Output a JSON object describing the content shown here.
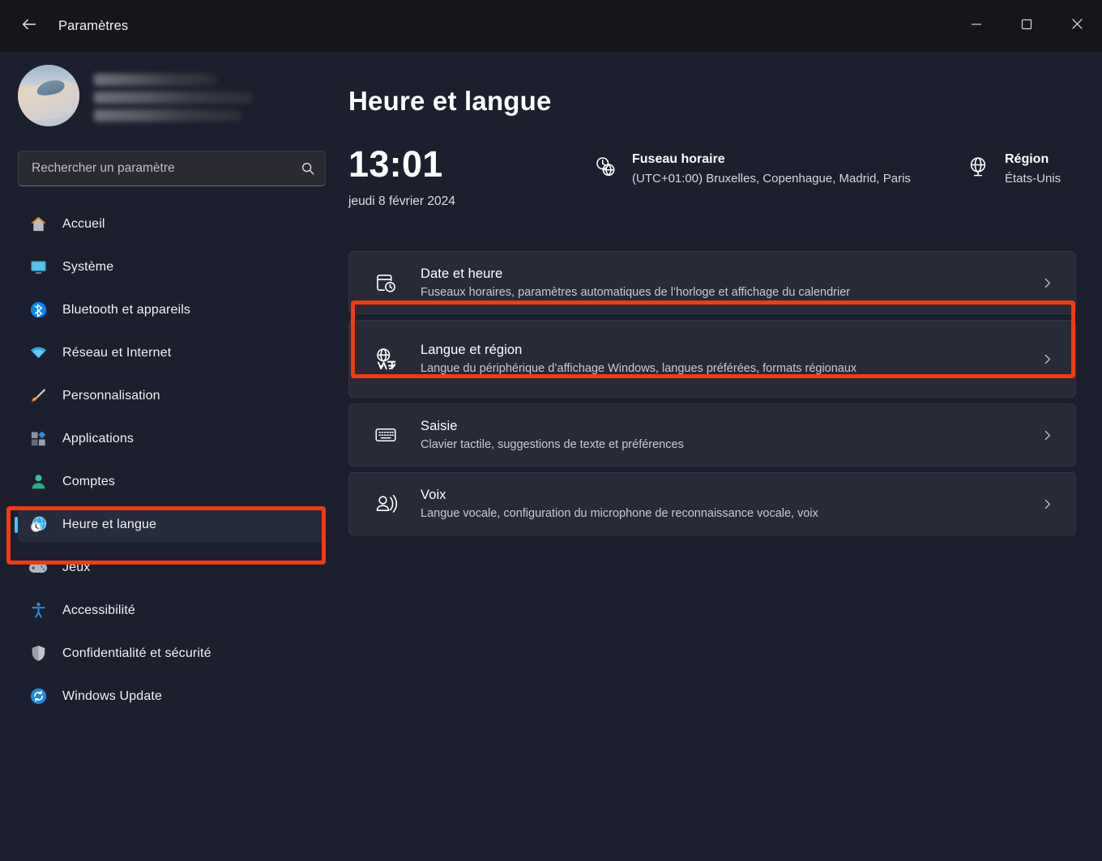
{
  "window": {
    "title": "Paramètres",
    "back_icon": "back-arrow-icon",
    "controls": {
      "minimize": "minimize-icon",
      "maximize": "maximize-icon",
      "close": "close-icon"
    }
  },
  "colors": {
    "background": "#1b1f2e",
    "titlebar": "#15151a",
    "card": "#272b38",
    "accent": "#4cc2ff",
    "highlight": "#f43a11",
    "text_primary": "#ffffff",
    "text_secondary": "#c9c9d2"
  },
  "sidebar": {
    "profile": {
      "avatar_icon": "user-avatar-photo",
      "name_redacted": true,
      "email_redacted": true
    },
    "search": {
      "placeholder": "Rechercher un paramètre",
      "value": "",
      "icon": "search-icon"
    },
    "items": [
      {
        "label": "Accueil",
        "icon": "home-icon",
        "active": false
      },
      {
        "label": "Système",
        "icon": "display-icon",
        "active": false
      },
      {
        "label": "Bluetooth et appareils",
        "icon": "bluetooth-icon",
        "active": false
      },
      {
        "label": "Réseau et Internet",
        "icon": "wifi-icon",
        "active": false
      },
      {
        "label": "Personnalisation",
        "icon": "paintbrush-icon",
        "active": false
      },
      {
        "label": "Applications",
        "icon": "apps-icon",
        "active": false
      },
      {
        "label": "Comptes",
        "icon": "account-icon",
        "active": false
      },
      {
        "label": "Heure et langue",
        "icon": "clock-globe-icon",
        "active": true
      },
      {
        "label": "Jeux",
        "icon": "gamepad-icon",
        "active": false
      },
      {
        "label": "Accessibilité",
        "icon": "accessibility-icon",
        "active": false
      },
      {
        "label": "Confidentialité et sécurité",
        "icon": "shield-icon",
        "active": false
      },
      {
        "label": "Windows Update",
        "icon": "update-icon",
        "active": false
      }
    ]
  },
  "main": {
    "page_title": "Heure et langue",
    "summary": {
      "time": "13:01",
      "date": "jeudi 8 février 2024",
      "timezone": {
        "icon": "clock-globe-icon",
        "label": "Fuseau horaire",
        "value": "(UTC+01:00) Bruxelles, Copenhague, Madrid, Paris"
      },
      "region": {
        "icon": "globe-stand-icon",
        "label": "Région",
        "value": "États-Unis"
      }
    },
    "cards": [
      {
        "title": "Date et heure",
        "subtitle": "Fuseaux horaires, paramètres automatiques de l’horloge et affichage du calendrier",
        "icon": "calendar-clock-icon",
        "chevron": "chevron-right-icon",
        "highlighted": false
      },
      {
        "title": "Langue et région",
        "subtitle": "Langue du périphérique d’affichage Windows, langues préférées, formats régionaux",
        "icon": "language-globe-icon",
        "chevron": "chevron-right-icon",
        "highlighted": true
      },
      {
        "title": "Saisie",
        "subtitle": "Clavier tactile, suggestions de texte et préférences",
        "icon": "keyboard-icon",
        "chevron": "chevron-right-icon",
        "highlighted": false
      },
      {
        "title": "Voix",
        "subtitle": "Langue vocale, configuration du microphone de reconnaissance vocale, voix",
        "icon": "speech-icon",
        "chevron": "chevron-right-icon",
        "highlighted": false
      }
    ]
  },
  "annotations": {
    "sidebar_highlight_target": "Heure et langue",
    "card_highlight_target": "Langue et région"
  }
}
